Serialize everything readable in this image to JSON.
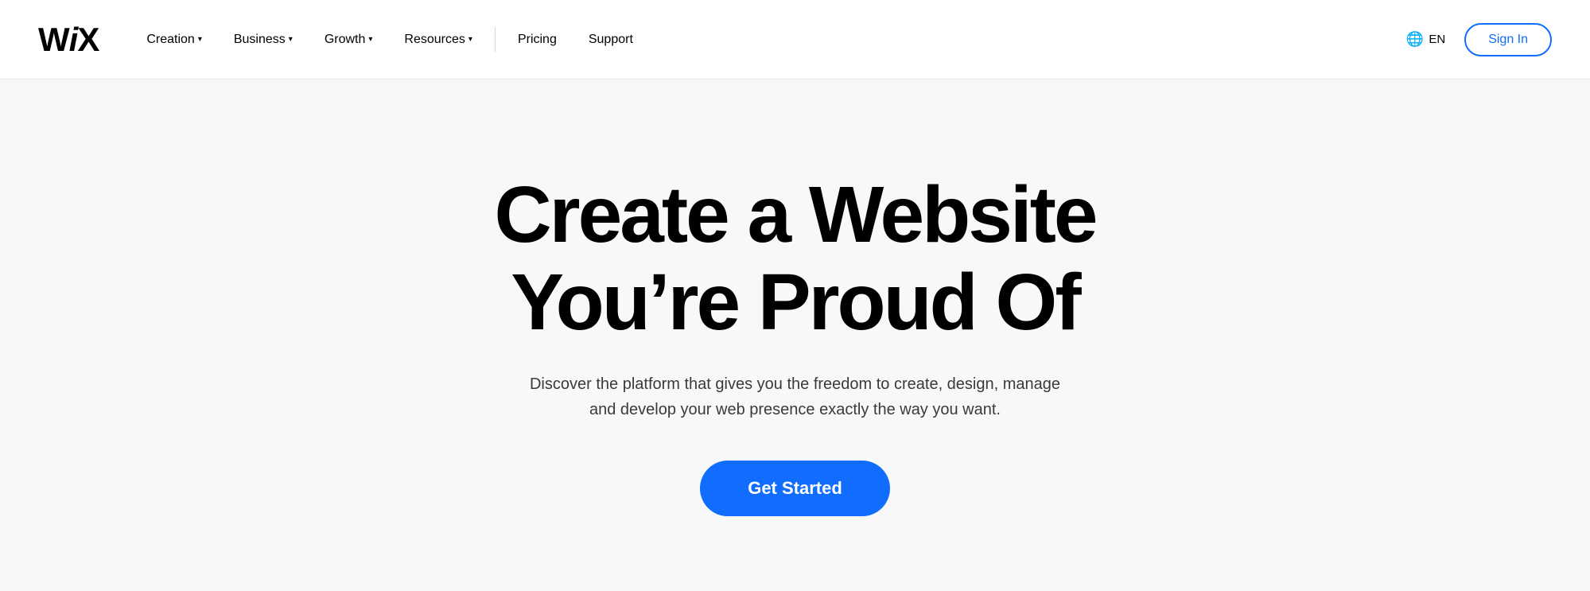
{
  "brand": {
    "logo": "WiX",
    "logo_w": "W",
    "logo_i": "i",
    "logo_x": "X"
  },
  "navbar": {
    "nav_items": [
      {
        "label": "Creation",
        "has_dropdown": true
      },
      {
        "label": "Business",
        "has_dropdown": true
      },
      {
        "label": "Growth",
        "has_dropdown": true
      },
      {
        "label": "Resources",
        "has_dropdown": true
      }
    ],
    "nav_items_simple": [
      {
        "label": "Pricing"
      },
      {
        "label": "Support"
      }
    ],
    "language": "EN",
    "sign_in": "Sign In"
  },
  "hero": {
    "title_line1": "Create a Website",
    "title_line2": "You’re Proud Of",
    "subtitle": "Discover the platform that gives you the freedom to create, design, manage and develop your web presence exactly the way you want.",
    "cta_button": "Get Started"
  }
}
